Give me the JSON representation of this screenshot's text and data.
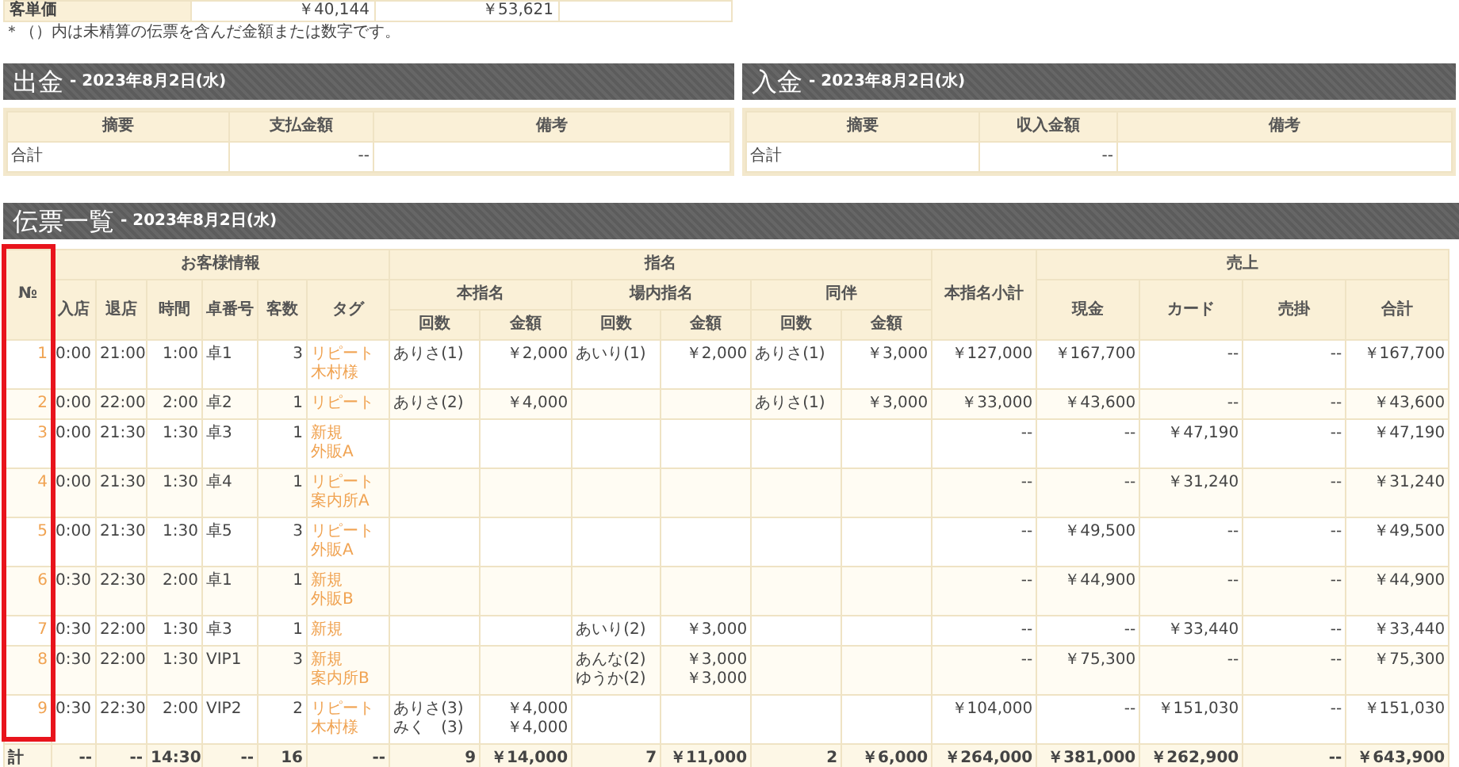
{
  "summary_row": {
    "label": "客単価",
    "values": [
      "￥40,144",
      "￥53,621"
    ]
  },
  "note": "＊（）内は未精算の伝票を含んだ金額または数字です。",
  "payments": [
    {
      "title": "出金",
      "date": "- 2023年8月2日(水)",
      "columns": [
        "摘要",
        "支払金額",
        "備考"
      ],
      "rows": [
        [
          "合計",
          "--"
        ]
      ]
    },
    {
      "title": "入金",
      "date": "- 2023年8月2日(水)",
      "columns": [
        "摘要",
        "収入金額",
        "備考"
      ],
      "rows": [
        [
          "合計",
          "--"
        ]
      ]
    }
  ],
  "slips": {
    "title": "伝票一覧",
    "date": "- 2023年8月2日(水)",
    "header": {
      "no": "№",
      "customer_group": "お客様情報",
      "customer_columns": [
        "入店",
        "退店",
        "時間",
        "卓番号",
        "客数",
        "タグ"
      ],
      "nomination_group": "指名",
      "nomination_subgroups": [
        {
          "label": "本指名",
          "columns": [
            "回数",
            "金額"
          ]
        },
        {
          "label": "場内指名",
          "columns": [
            "回数",
            "金額"
          ]
        },
        {
          "label": "同伴",
          "columns": [
            "回数",
            "金額"
          ]
        }
      ],
      "subtotal": "本指名小計",
      "sales_group": "売上",
      "sales_columns": [
        "現金",
        "カード",
        "売掛",
        "合計"
      ]
    },
    "rows": [
      {
        "no": "1",
        "in": "0:00",
        "out": "21:00",
        "time": "1:00",
        "table": "卓1",
        "guests": "3",
        "tags": [
          "リピート",
          "木村様"
        ],
        "main": {
          "names": [
            "ありさ(1)"
          ],
          "amounts": [
            "￥2,000"
          ]
        },
        "in_store": {
          "names": [
            "あいり(1)"
          ],
          "amounts": [
            "￥2,000"
          ]
        },
        "companion": {
          "names": [
            "ありさ(1)"
          ],
          "amounts": [
            "￥3,000"
          ]
        },
        "subtotal": "￥127,000",
        "cash": "￥167,700",
        "card": "--",
        "credit": "--",
        "total": "￥167,700"
      },
      {
        "no": "2",
        "in": "0:00",
        "out": "22:00",
        "time": "2:00",
        "table": "卓2",
        "guests": "1",
        "tags": [
          "リピート"
        ],
        "main": {
          "names": [
            "ありさ(2)"
          ],
          "amounts": [
            "￥4,000"
          ]
        },
        "companion": {
          "names": [
            "ありさ(1)"
          ],
          "amounts": [
            "￥3,000"
          ]
        },
        "subtotal": "￥33,000",
        "cash": "￥43,600",
        "card": "--",
        "credit": "--",
        "total": "￥43,600"
      },
      {
        "no": "3",
        "in": "0:00",
        "out": "21:30",
        "time": "1:30",
        "table": "卓3",
        "guests": "1",
        "tags": [
          "新規",
          "外販A"
        ],
        "subtotal": "--",
        "cash": "--",
        "card": "￥47,190",
        "credit": "--",
        "total": "￥47,190"
      },
      {
        "no": "4",
        "in": "0:00",
        "out": "21:30",
        "time": "1:30",
        "table": "卓4",
        "guests": "1",
        "tags": [
          "リピート",
          "案内所A"
        ],
        "subtotal": "--",
        "cash": "--",
        "card": "￥31,240",
        "credit": "--",
        "total": "￥31,240"
      },
      {
        "no": "5",
        "in": "0:00",
        "out": "21:30",
        "time": "1:30",
        "table": "卓5",
        "guests": "3",
        "tags": [
          "リピート",
          "外販A"
        ],
        "subtotal": "--",
        "cash": "￥49,500",
        "card": "--",
        "credit": "--",
        "total": "￥49,500"
      },
      {
        "no": "6",
        "in": "0:30",
        "out": "22:30",
        "time": "2:00",
        "table": "卓1",
        "guests": "1",
        "tags": [
          "新規",
          "外販B"
        ],
        "subtotal": "--",
        "cash": "￥44,900",
        "card": "--",
        "credit": "--",
        "total": "￥44,900"
      },
      {
        "no": "7",
        "in": "0:30",
        "out": "22:00",
        "time": "1:30",
        "table": "卓3",
        "guests": "1",
        "tags": [
          "新規"
        ],
        "in_store": {
          "names": [
            "あいり(2)"
          ],
          "amounts": [
            "￥3,000"
          ]
        },
        "subtotal": "--",
        "cash": "--",
        "card": "￥33,440",
        "credit": "--",
        "total": "￥33,440"
      },
      {
        "no": "8",
        "in": "0:30",
        "out": "22:00",
        "time": "1:30",
        "table": "VIP1",
        "guests": "3",
        "tags": [
          "新規",
          "案内所B"
        ],
        "in_store": {
          "names": [
            "あんな(2)",
            "ゆうか(2)"
          ],
          "amounts": [
            "￥3,000",
            "￥3,000"
          ]
        },
        "subtotal": "--",
        "cash": "￥75,300",
        "card": "--",
        "credit": "--",
        "total": "￥75,300"
      },
      {
        "no": "9",
        "in": "0:30",
        "out": "22:30",
        "time": "2:00",
        "table": "VIP2",
        "guests": "2",
        "tags": [
          "リピート",
          "木村様"
        ],
        "main": {
          "names": [
            "ありさ(3)",
            "みく　(3)"
          ],
          "amounts": [
            "￥4,000",
            "￥4,000"
          ]
        },
        "subtotal": "￥104,000",
        "cash": "--",
        "card": "￥151,030",
        "credit": "--",
        "total": "￥151,030"
      }
    ],
    "total_row": {
      "label": "計",
      "cells": [
        "--",
        "--",
        "14:30",
        "--",
        "16",
        "--",
        "9",
        "￥14,000",
        "7",
        "￥11,000",
        "2",
        "￥6,000",
        "￥264,000",
        "￥381,000",
        "￥262,900",
        "--",
        "￥643,900"
      ]
    },
    "annotation": {
      "kind": "frame"
    }
  }
}
